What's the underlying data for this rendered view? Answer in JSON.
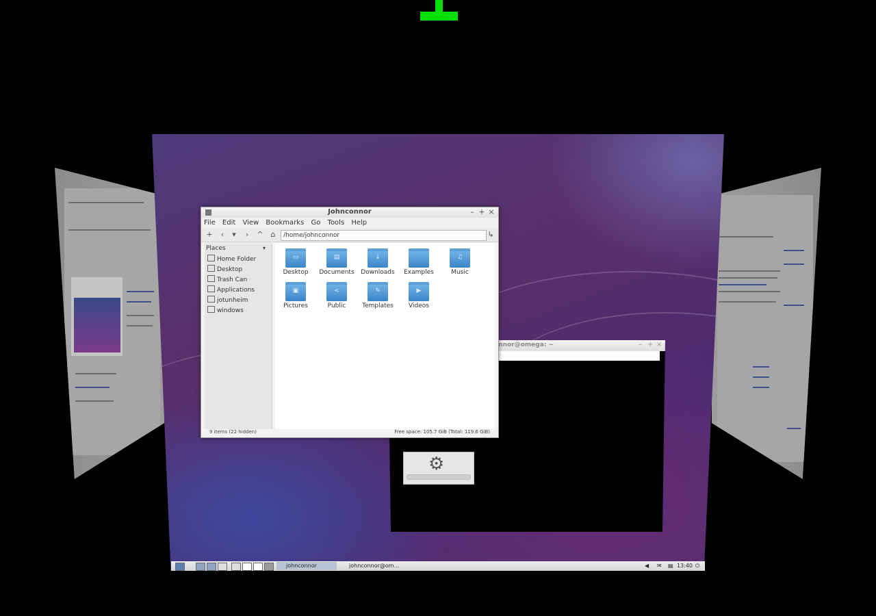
{
  "file_manager": {
    "title": "Johnconnor",
    "menu": [
      "File",
      "Edit",
      "View",
      "Bookmarks",
      "Go",
      "Tools",
      "Help"
    ],
    "path": "/home/johnconnor",
    "sidebar_header": "Places",
    "places": [
      "Home Folder",
      "Desktop",
      "Trash Can",
      "Applications",
      "jotunheim",
      "windows"
    ],
    "folders": [
      "Desktop",
      "Documents",
      "Downloads",
      "Examples",
      "Music",
      "Pictures",
      "Public",
      "Templates",
      "Videos"
    ],
    "status_left": "9 items (22 hidden)",
    "status_right": "Free space: 105.7 GiB (Total: 119.6 GiB)"
  },
  "terminal": {
    "title": "onnor@omega: ~"
  },
  "taskbar": {
    "task1": "johnconnor",
    "task2": "johnconnor@om...",
    "clock": "13:40"
  },
  "colors": {
    "marker": "#00e000",
    "folder": "#3b86c8"
  }
}
